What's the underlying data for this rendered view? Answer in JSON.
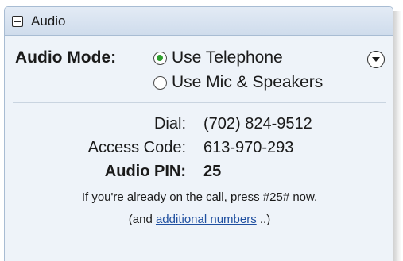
{
  "panel": {
    "title": "Audio"
  },
  "audio_mode": {
    "label": "Audio Mode:",
    "options": [
      {
        "label": "Use Telephone",
        "selected": true
      },
      {
        "label": "Use Mic & Speakers",
        "selected": false
      }
    ]
  },
  "dial": {
    "label": "Dial:",
    "value": "(702) 824-9512"
  },
  "access_code": {
    "label": "Access Code:",
    "value": "613-970-293"
  },
  "audio_pin": {
    "label": "Audio PIN:",
    "value": "25"
  },
  "note": {
    "text": "If you're already on the call, press #25# now.",
    "prefix": "(and ",
    "link": "additional numbers",
    "suffix": " ..)"
  },
  "colors": {
    "selected_radio": "#2e9e2e",
    "link": "#1f4fa0",
    "panel_bg": "#eef3f9"
  }
}
